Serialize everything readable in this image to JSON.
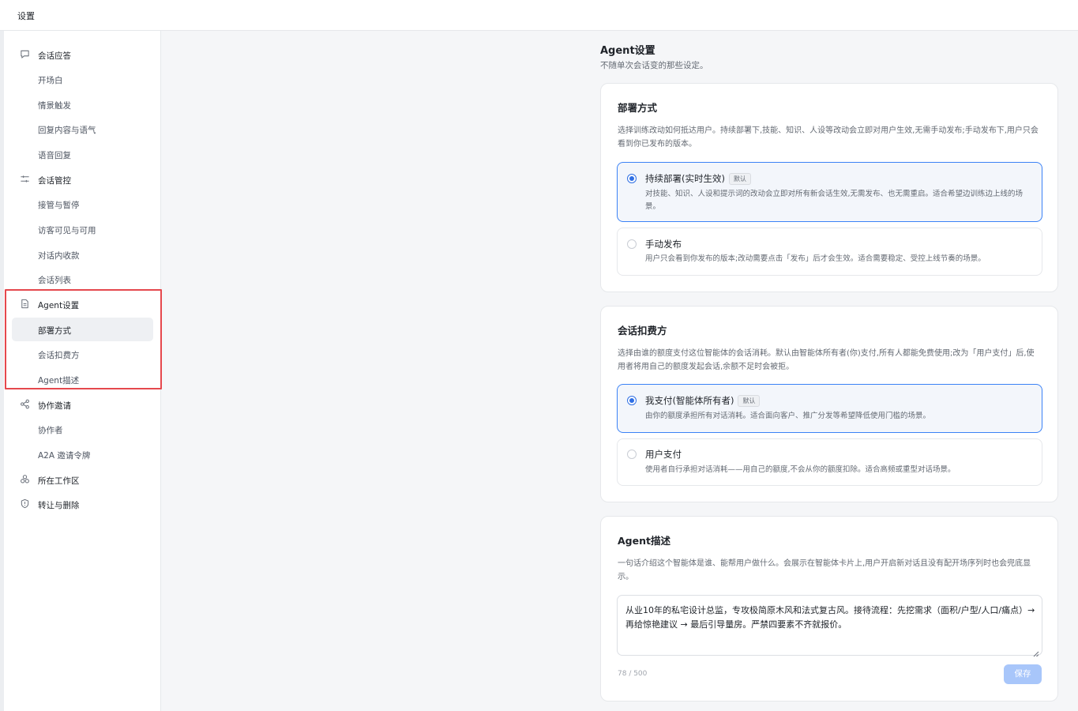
{
  "header": {
    "title": "设置"
  },
  "sidebar": {
    "items": [
      {
        "label": "会话应答",
        "icon": "chat-bubble-icon",
        "group": true
      },
      {
        "label": "开场白"
      },
      {
        "label": "情景触发"
      },
      {
        "label": "回复内容与语气"
      },
      {
        "label": "语音回复"
      },
      {
        "label": "会话管控",
        "icon": "sliders-icon",
        "group": true
      },
      {
        "label": "接管与暂停"
      },
      {
        "label": "访客可见与可用"
      },
      {
        "label": "对话内收款"
      },
      {
        "label": "会话列表"
      },
      {
        "label": "Agent设置",
        "icon": "document-icon",
        "group": true
      },
      {
        "label": "部署方式",
        "active": true
      },
      {
        "label": "会话扣费方"
      },
      {
        "label": "Agent描述"
      },
      {
        "label": "协作邀请",
        "icon": "share-icon",
        "group": true
      },
      {
        "label": "协作者"
      },
      {
        "label": "A2A 邀请令牌"
      },
      {
        "label": "所在工作区",
        "icon": "workspace-icon",
        "group": true
      },
      {
        "label": "转让与删除",
        "icon": "shield-icon",
        "group": true
      }
    ]
  },
  "main": {
    "title": "Agent设置",
    "subtitle": "不随单次会话变的那些设定。",
    "deploy": {
      "title": "部署方式",
      "desc": "选择训练改动如何抵达用户。持续部署下,技能、知识、人设等改动会立即对用户生效,无需手动发布;手动发布下,用户只会看到你已发布的版本。",
      "options": [
        {
          "title": "持续部署(实时生效)",
          "badge": "默认",
          "desc": "对技能、知识、人设和提示词的改动会立即对所有新会话生效,无需发布、也无需重启。适合希望边训练边上线的场景。",
          "selected": true
        },
        {
          "title": "手动发布",
          "desc": "用户只会看到你发布的版本;改动需要点击「发布」后才会生效。适合需要稳定、受控上线节奏的场景。",
          "selected": false
        }
      ]
    },
    "billing": {
      "title": "会话扣费方",
      "desc": "选择由谁的额度支付这位智能体的会话消耗。默认由智能体所有者(你)支付,所有人都能免费使用;改为「用户支付」后,使用者将用自己的额度发起会话,余额不足时会被拒。",
      "options": [
        {
          "title": "我支付(智能体所有者)",
          "badge": "默认",
          "desc": "由你的额度承担所有对话消耗。适合面向客户、推广分发等希望降低使用门槛的场景。",
          "selected": true
        },
        {
          "title": "用户支付",
          "desc": "使用者自行承担对话消耗——用自己的额度,不会从你的额度扣除。适合高频或重型对话场景。",
          "selected": false
        }
      ]
    },
    "description": {
      "title": "Agent描述",
      "desc": "一句话介绍这个智能体是谁、能帮用户做什么。会展示在智能体卡片上,用户开启新对话且没有配开场序列时也会兜底显示。",
      "value": "从业10年的私宅设计总监，专攻极简原木风和法式复古风。接待流程：先挖需求（面积/户型/人口/痛点）→ 再给惊艳建议 → 最后引导量房。严禁四要素不齐就报价。",
      "counter": "78 / 500",
      "save_label": "保存"
    }
  }
}
